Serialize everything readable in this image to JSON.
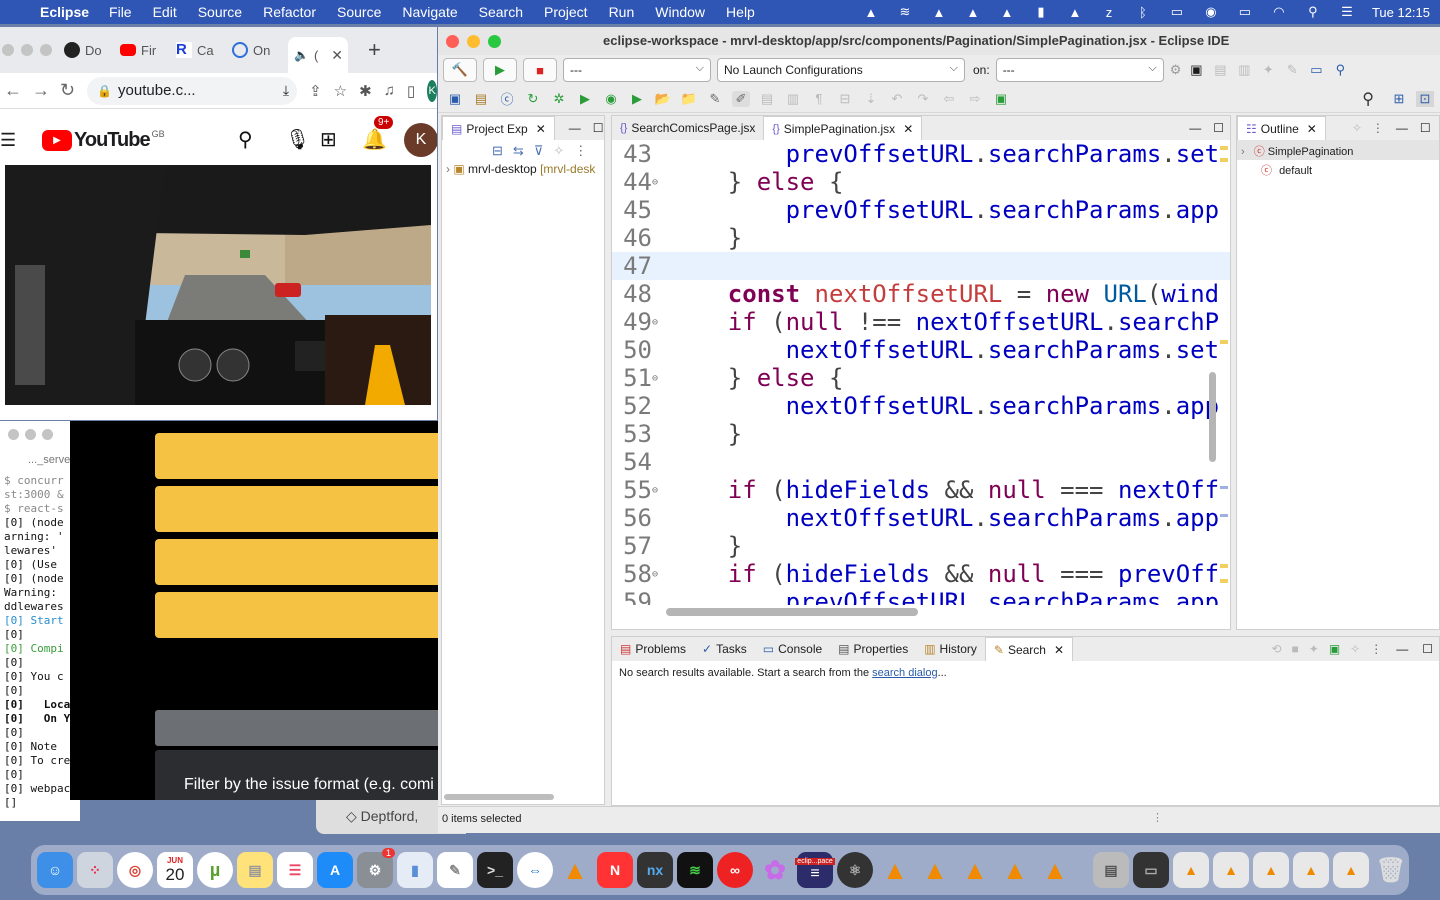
{
  "menubar": {
    "app_name": "Eclipse",
    "items": [
      "File",
      "Edit",
      "Source",
      "Refactor",
      "Source",
      "Navigate",
      "Search",
      "Project",
      "Run",
      "Window",
      "Help"
    ],
    "clock": "Tue 12:15"
  },
  "chrome": {
    "tabs": [
      "Do",
      "Fir",
      "Ca",
      "On",
      "("
    ],
    "url": "youtube.c...",
    "profile_initial": "K"
  },
  "youtube": {
    "logo_text": "YouTube",
    "region": "GB",
    "notification_count": "9+",
    "avatar_initial": "K"
  },
  "terminal": {
    "title": "..._serve",
    "lines": [
      {
        "t": "$ concurr",
        "c": "grey"
      },
      {
        "t": "st:3000 &",
        "c": "grey"
      },
      {
        "t": "$ react-s",
        "c": "grey"
      },
      {
        "t": "[0] (node",
        "c": ""
      },
      {
        "t": "arning: '",
        "c": ""
      },
      {
        "t": "lewares' ",
        "c": ""
      },
      {
        "t": "[0] (Use ",
        "c": ""
      },
      {
        "t": "[0] (node",
        "c": ""
      },
      {
        "t": "Warning: ",
        "c": ""
      },
      {
        "t": "ddlewares",
        "c": ""
      },
      {
        "t": "[0] Start",
        "c": "blue"
      },
      {
        "t": "[0]",
        "c": ""
      },
      {
        "t": "[0] Compi",
        "c": "green"
      },
      {
        "t": "[0]",
        "c": ""
      },
      {
        "t": "[0] You c",
        "c": ""
      },
      {
        "t": "[0]",
        "c": ""
      },
      {
        "t": "[0]   Loca",
        "c": "bold"
      },
      {
        "t": "[0]   On Y",
        "c": "bold"
      },
      {
        "t": "[0]",
        "c": ""
      },
      {
        "t": "[0] Note ",
        "c": ""
      },
      {
        "t": "[0] To cre",
        "c": ""
      },
      {
        "t": "[0]",
        "c": ""
      },
      {
        "t": "[0] webpac",
        "c": ""
      },
      {
        "t": "[]",
        "c": ""
      }
    ]
  },
  "dark_app": {
    "filter_text": "Filter by the issue format (e.g. comi"
  },
  "behind_window_text": "Deptford,",
  "eclipse": {
    "title": "eclipse-workspace - mrvl-desktop/app/src/components/Pagination/SimplePagination.jsx - Eclipse IDE",
    "launch_mode": "---",
    "launch_config": "No Launch Configurations",
    "on_label": "on:",
    "target": "---",
    "project_explorer": {
      "tab": "Project Exp",
      "root": "mrvl-desktop",
      "root_suffix": "[mrvl-desk"
    },
    "editor_tabs": [
      "SearchComicsPage.jsx",
      "SimplePagination.jsx"
    ],
    "code_lines": [
      {
        "n": "43",
        "fold": "",
        "cur": false,
        "parts": [
          {
            "t": "        prevOffsetURL",
            "c": "fld"
          },
          {
            "t": ".",
            "c": "op"
          },
          {
            "t": "searchParams",
            "c": "fld"
          },
          {
            "t": ".",
            "c": "op"
          },
          {
            "t": "set",
            "c": "fld"
          }
        ]
      },
      {
        "n": "44",
        "fold": "⊖",
        "cur": false,
        "parts": [
          {
            "t": "    } ",
            "c": "op"
          },
          {
            "t": "else",
            "c": "kw2"
          },
          {
            "t": " {",
            "c": "op"
          }
        ]
      },
      {
        "n": "45",
        "fold": "",
        "cur": false,
        "parts": [
          {
            "t": "        prevOffsetURL",
            "c": "fld"
          },
          {
            "t": ".",
            "c": "op"
          },
          {
            "t": "searchParams",
            "c": "fld"
          },
          {
            "t": ".",
            "c": "op"
          },
          {
            "t": "app",
            "c": "fld"
          }
        ]
      },
      {
        "n": "46",
        "fold": "",
        "cur": false,
        "parts": [
          {
            "t": "    }",
            "c": "op"
          }
        ]
      },
      {
        "n": "47",
        "fold": "",
        "cur": true,
        "parts": [
          {
            "t": "",
            "c": "op"
          }
        ]
      },
      {
        "n": "48",
        "fold": "",
        "cur": false,
        "parts": [
          {
            "t": "    ",
            "c": "op"
          },
          {
            "t": "const",
            "c": "kw"
          },
          {
            "t": " ",
            "c": "op"
          },
          {
            "t": "nextOffsetURL",
            "c": "var"
          },
          {
            "t": " = ",
            "c": "op"
          },
          {
            "t": "new",
            "c": "kw2"
          },
          {
            "t": " ",
            "c": "op"
          },
          {
            "t": "URL",
            "c": "hl"
          },
          {
            "t": "(",
            "c": "op"
          },
          {
            "t": "wind",
            "c": "fld"
          }
        ]
      },
      {
        "n": "49",
        "fold": "⊖",
        "cur": false,
        "parts": [
          {
            "t": "    ",
            "c": "op"
          },
          {
            "t": "if",
            "c": "kw2"
          },
          {
            "t": " (",
            "c": "op"
          },
          {
            "t": "null",
            "c": "kw2"
          },
          {
            "t": " !== ",
            "c": "op"
          },
          {
            "t": "nextOffsetURL",
            "c": "fld"
          },
          {
            "t": ".",
            "c": "op"
          },
          {
            "t": "searchP",
            "c": "fld"
          }
        ]
      },
      {
        "n": "50",
        "fold": "",
        "cur": false,
        "parts": [
          {
            "t": "        nextOffsetURL",
            "c": "fld"
          },
          {
            "t": ".",
            "c": "op"
          },
          {
            "t": "searchParams",
            "c": "fld"
          },
          {
            "t": ".",
            "c": "op"
          },
          {
            "t": "set",
            "c": "fld"
          }
        ]
      },
      {
        "n": "51",
        "fold": "⊖",
        "cur": false,
        "parts": [
          {
            "t": "    } ",
            "c": "op"
          },
          {
            "t": "else",
            "c": "kw2"
          },
          {
            "t": " {",
            "c": "op"
          }
        ]
      },
      {
        "n": "52",
        "fold": "",
        "cur": false,
        "parts": [
          {
            "t": "        nextOffsetURL",
            "c": "fld"
          },
          {
            "t": ".",
            "c": "op"
          },
          {
            "t": "searchParams",
            "c": "fld"
          },
          {
            "t": ".",
            "c": "op"
          },
          {
            "t": "app",
            "c": "fld"
          }
        ]
      },
      {
        "n": "53",
        "fold": "",
        "cur": false,
        "parts": [
          {
            "t": "    }",
            "c": "op"
          }
        ]
      },
      {
        "n": "54",
        "fold": "",
        "cur": false,
        "parts": [
          {
            "t": "",
            "c": "op"
          }
        ]
      },
      {
        "n": "55",
        "fold": "⊖",
        "cur": false,
        "parts": [
          {
            "t": "    ",
            "c": "op"
          },
          {
            "t": "if",
            "c": "kw2"
          },
          {
            "t": " (",
            "c": "op"
          },
          {
            "t": "hideFields",
            "c": "fld"
          },
          {
            "t": " && ",
            "c": "op"
          },
          {
            "t": "null",
            "c": "kw2"
          },
          {
            "t": " === ",
            "c": "op"
          },
          {
            "t": "nextOff",
            "c": "fld"
          }
        ]
      },
      {
        "n": "56",
        "fold": "",
        "cur": false,
        "parts": [
          {
            "t": "        nextOffsetURL",
            "c": "fld"
          },
          {
            "t": ".",
            "c": "op"
          },
          {
            "t": "searchParams",
            "c": "fld"
          },
          {
            "t": ".",
            "c": "op"
          },
          {
            "t": "app",
            "c": "fld"
          }
        ]
      },
      {
        "n": "57",
        "fold": "",
        "cur": false,
        "parts": [
          {
            "t": "    }",
            "c": "op"
          }
        ]
      },
      {
        "n": "58",
        "fold": "⊖",
        "cur": false,
        "parts": [
          {
            "t": "    ",
            "c": "op"
          },
          {
            "t": "if",
            "c": "kw2"
          },
          {
            "t": " (",
            "c": "op"
          },
          {
            "t": "hideFields",
            "c": "fld"
          },
          {
            "t": " && ",
            "c": "op"
          },
          {
            "t": "null",
            "c": "kw2"
          },
          {
            "t": " === ",
            "c": "op"
          },
          {
            "t": "prevOff",
            "c": "fld"
          }
        ]
      },
      {
        "n": "59",
        "fold": "",
        "cur": false,
        "parts": [
          {
            "t": "        prevOffsetURL",
            "c": "fld"
          },
          {
            "t": ".",
            "c": "op"
          },
          {
            "t": "searchParams",
            "c": "fld"
          },
          {
            "t": ".",
            "c": "op"
          },
          {
            "t": "app",
            "c": "fld"
          }
        ]
      }
    ],
    "outline": {
      "tab": "Outline",
      "items": [
        "SimplePagination",
        "default"
      ]
    },
    "bottom_tabs": [
      "Problems",
      "Tasks",
      "Console",
      "Properties",
      "History",
      "Search"
    ],
    "search_message": "No search results available. Start a search from the ",
    "search_link": "search dialog",
    "search_suffix": "...",
    "status": "0 items selected"
  },
  "dock": {
    "calendar_month": "JUN",
    "calendar_day": "20",
    "sysprefs_badge": "1",
    "eclipse_label": "eclip...pace"
  },
  "colors": {
    "menubar": "#2f56b5",
    "youtube_red": "#ff0000",
    "yellow_button": "#f6c243",
    "keyword": "#7f0055",
    "field": "#0000c0",
    "variable": "#c43d3d"
  }
}
